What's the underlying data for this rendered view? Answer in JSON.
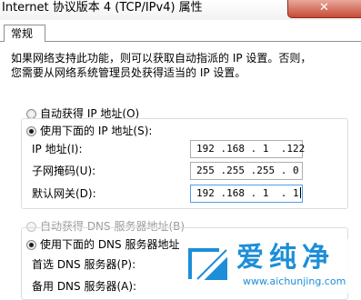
{
  "window": {
    "title": "Internet 协议版本 4 (TCP/IPv4) 属性"
  },
  "tabs": [
    {
      "label": "常规"
    }
  ],
  "general": {
    "description_line1": "如果网络支持此功能，则可以获取自动指派的 IP 设置。否则，",
    "description_line2": "您需要从网络系统管理员处获得适当的 IP 设置。",
    "ip_group": {
      "auto_label": "自动获得 IP 地址(O)",
      "auto_selected": false,
      "manual_label": "使用下面的 IP 地址(S):",
      "manual_selected": true,
      "fields": [
        {
          "label": "IP 地址(I):",
          "value": "192 .168 . 1  .122"
        },
        {
          "label": "子网掩码(U):",
          "value": "255 .255 .255 . 0"
        },
        {
          "label": "默认网关(D):",
          "value": "192 .168 . 1  . 1"
        }
      ]
    },
    "dns_group": {
      "auto_label": "自动获得 DNS 服务器地址(B)",
      "auto_selected": false,
      "manual_label": "使用下面的 DNS 服务器地址",
      "manual_selected": true,
      "fields": [
        {
          "label": "首选 DNS 服务器(P):"
        },
        {
          "label": "备用 DNS 服务器(A):"
        }
      ]
    }
  },
  "watermark": {
    "name": "爱纯净",
    "url": "www.aichunjing.com",
    "color": "#1d8ed8"
  }
}
